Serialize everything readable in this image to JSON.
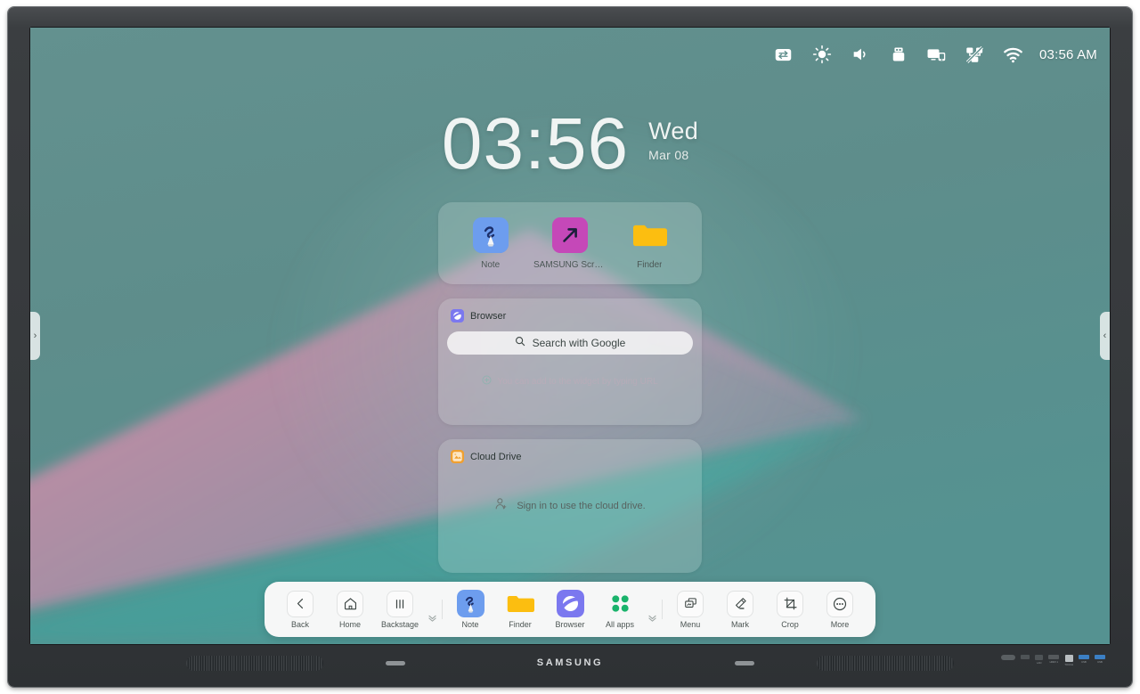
{
  "device": {
    "brand": "SAMSUNG",
    "type": "interactive-display",
    "hardware": {
      "speaker_left": "speaker-grille",
      "speaker_right": "speaker-grille",
      "ir_sensor_left": "ir-sensor",
      "ir_sensor_right": "ir-sensor"
    },
    "ports": [
      {
        "name": "power-port",
        "label": ""
      },
      {
        "name": "rs232-port",
        "label": ""
      },
      {
        "name": "lan-port",
        "label": "LAN"
      },
      {
        "name": "hdmi-port",
        "label": "HDMI 1"
      },
      {
        "name": "touch-port",
        "label": "TOUCH"
      },
      {
        "name": "usb-port-1",
        "label": "USB"
      },
      {
        "name": "usb-port-2",
        "label": "USB"
      }
    ]
  },
  "status_bar": {
    "time": "03:56 AM",
    "icons": [
      {
        "name": "input-source-icon",
        "title": "Source"
      },
      {
        "name": "brightness-icon",
        "title": "Brightness"
      },
      {
        "name": "volume-icon",
        "title": "Volume"
      },
      {
        "name": "usb-icon",
        "title": "USB"
      },
      {
        "name": "screen-share-icon",
        "title": "Screen share"
      },
      {
        "name": "network-off-icon",
        "title": "Network disconnected"
      },
      {
        "name": "wifi-icon",
        "title": "Wi-Fi"
      }
    ]
  },
  "clock": {
    "time": "03:56",
    "weekday": "Wed",
    "date": "Mar 08"
  },
  "shortcuts_widget": {
    "items": [
      {
        "label": "Note",
        "icon": "note-app-icon"
      },
      {
        "label": "SAMSUNG Screen...",
        "icon": "samsung-screen-app-icon"
      },
      {
        "label": "Finder",
        "icon": "finder-app-icon"
      }
    ]
  },
  "browser_widget": {
    "title": "Browser",
    "icon": "browser-app-icon",
    "search_placeholder": "Search with Google",
    "search_value": "",
    "hint": "You can add to the widget by typing URL"
  },
  "cloud_widget": {
    "title": "Cloud Drive",
    "icon": "cloud-drive-app-icon",
    "signin_text": "Sign in to use the cloud drive."
  },
  "side_handles": {
    "left_glyph": "›",
    "right_glyph": "‹"
  },
  "taskbar": {
    "nav": [
      {
        "label": "Back",
        "icon": "back-icon"
      },
      {
        "label": "Home",
        "icon": "home-icon"
      },
      {
        "label": "Backstage",
        "icon": "backstage-icon"
      }
    ],
    "apps": [
      {
        "label": "Note",
        "icon": "note-app-icon"
      },
      {
        "label": "Finder",
        "icon": "finder-app-icon"
      },
      {
        "label": "Browser",
        "icon": "browser-app-icon"
      },
      {
        "label": "All apps",
        "icon": "all-apps-icon"
      }
    ],
    "tools": [
      {
        "label": "Menu",
        "icon": "menu-icon"
      },
      {
        "label": "Mark",
        "icon": "mark-icon"
      },
      {
        "label": "Crop",
        "icon": "crop-icon"
      },
      {
        "label": "More",
        "icon": "more-icon"
      }
    ],
    "collapse_glyph": "ˇ"
  },
  "colors": {
    "wallpaper_teal": "#5f8e8c",
    "wallpaper_pink": "#d98ca4",
    "accent_green": "#19b36b",
    "note_blue": "#6d9dee",
    "screen_magenta": "#c548b8",
    "finder_yellow": "#fcbe10",
    "browser_purple": "#7b78ef",
    "cloud_orange": "#f0a030",
    "taskbar_bg": "#f6f7f7"
  }
}
